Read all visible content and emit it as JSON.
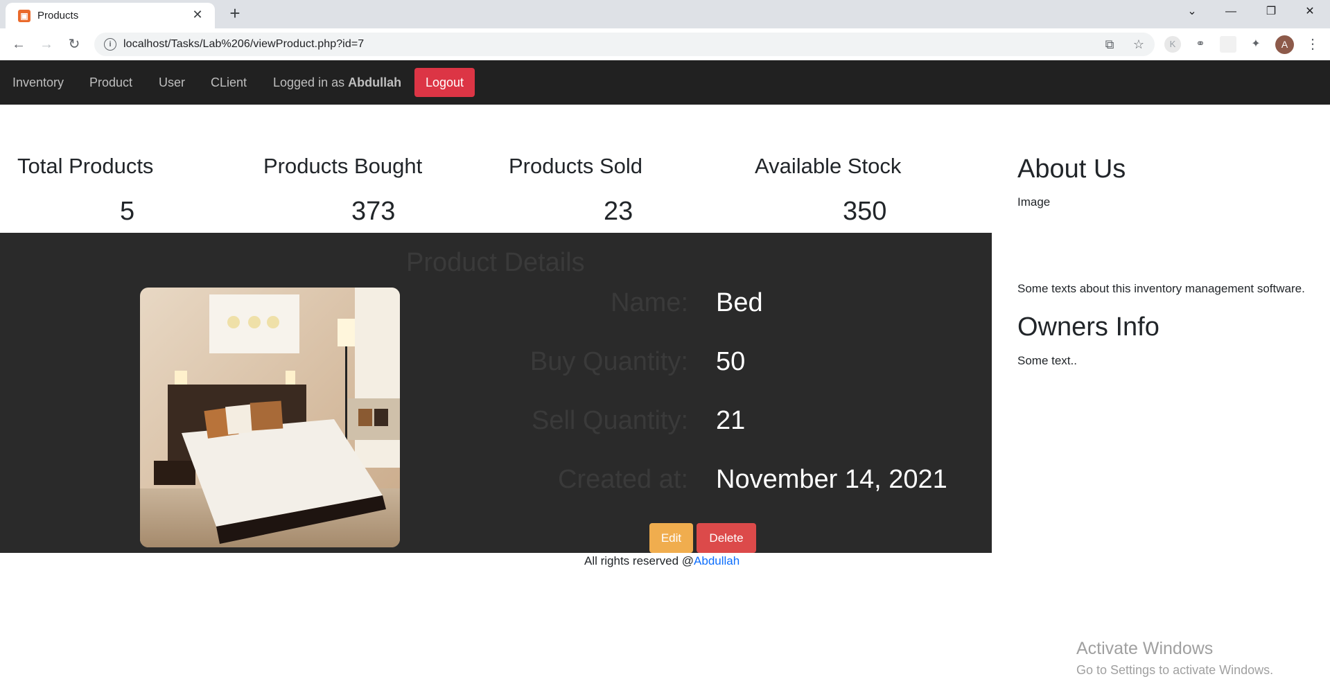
{
  "browser": {
    "tab_title": "Products",
    "favicon_letter": "⊠",
    "url": "localhost/Tasks/Lab%206/viewProduct.php?id=7",
    "avatar_letter": "A"
  },
  "nav": {
    "links": [
      "Inventory",
      "Product",
      "User",
      "CLient"
    ],
    "logged_prefix": "Logged in as ",
    "logged_user": "Abdullah",
    "logout_label": "Logout"
  },
  "stats": [
    {
      "label": "Total Products",
      "value": "5"
    },
    {
      "label": "Products Bought",
      "value": "373"
    },
    {
      "label": "Products Sold",
      "value": "23"
    },
    {
      "label": "Available Stock",
      "value": "350"
    }
  ],
  "details": {
    "heading": "Product Details",
    "name_label": "Name:",
    "name_value": "Bed",
    "buy_label": "Buy Quantity:",
    "buy_value": "50",
    "sell_label": "Sell Quantity:",
    "sell_value": "21",
    "created_label": "Created at:",
    "created_value": "November 14, 2021",
    "edit_label": "Edit",
    "delete_label": "Delete"
  },
  "sidebar": {
    "about_heading": "About Us",
    "image_text": "Image",
    "about_text": "Some texts about this inventory management software.",
    "owners_heading": "Owners Info",
    "owners_text": "Some text.."
  },
  "footer": {
    "text": "All rights reserved @",
    "link": "Abdullah"
  },
  "watermark": {
    "title": "Activate Windows",
    "subtitle": "Go to Settings to activate Windows."
  },
  "colors": {
    "navbar": "#212121",
    "panel": "#2a2a2a",
    "danger": "#dc3545",
    "warning": "#f0ad4e"
  }
}
